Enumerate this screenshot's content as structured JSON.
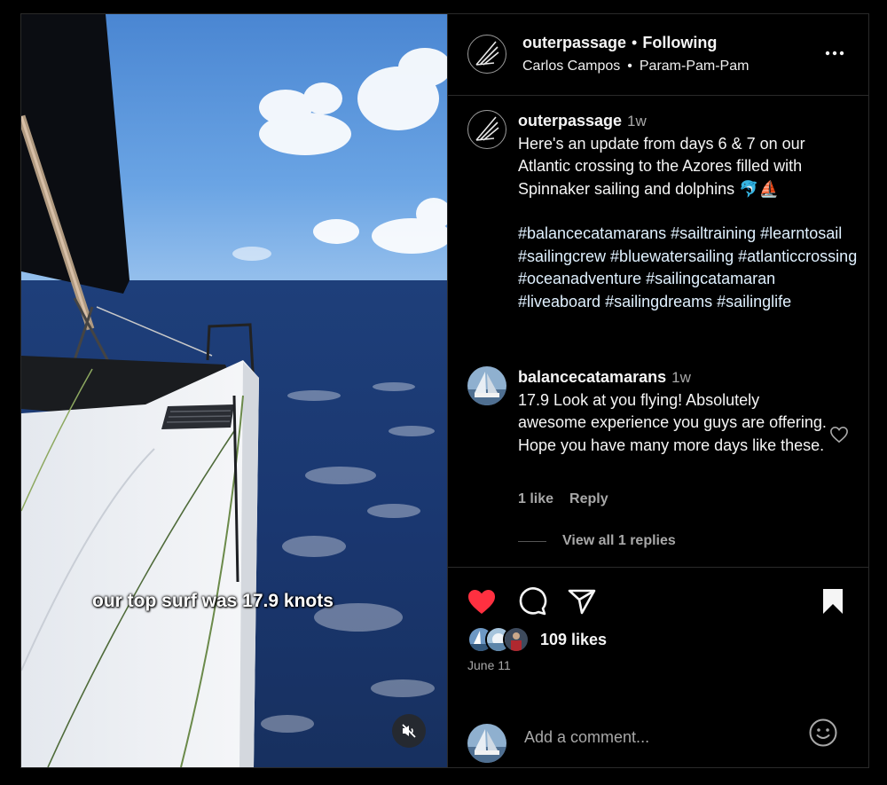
{
  "media": {
    "subtitle": "our top surf was 17.9 knots",
    "mute_icon": "speaker-muted-icon"
  },
  "header": {
    "username": "outerpassage",
    "separator": "•",
    "follow_status": "Following",
    "audio_artist": "Carlos Campos",
    "audio_track": "Param-Pam-Pam",
    "more_icon": "more-horizontal-icon"
  },
  "caption": {
    "username": "outerpassage",
    "time": "1w",
    "text": "Here's an update from days 6 & 7 on our Atlantic crossing to the Azores filled with Spinnaker sailing and dolphins 🐬⛵",
    "hashtags": "#balancecatamarans #sailtraining #learntosail #sailingcrew #bluewatersailing #atlanticcrossing #oceanadventure #sailingcatamaran #liveaboard #sailingdreams #sailinglife"
  },
  "comment": {
    "username": "balancecatamarans",
    "time": "1w",
    "text": "17.9 Look at you flying! Absolutely awesome experience you guys are offering. Hope you have many more days like these.",
    "likes": "1 like",
    "reply_label": "Reply",
    "view_replies": "View all 1 replies"
  },
  "actions": {
    "like_icon": "heart-filled-icon",
    "comment_icon": "comment-bubble-icon",
    "share_icon": "paper-plane-icon",
    "save_icon": "bookmark-filled-icon",
    "likes_count": "109 likes",
    "date": "June 11"
  },
  "add_comment": {
    "placeholder": "Add a comment...",
    "emoji_icon": "emoji-smile-icon"
  },
  "colors": {
    "background": "#000000",
    "like_red": "#ff3040",
    "secondary_text": "#a8a8a8",
    "hashtag_blue": "#e0f1ff"
  }
}
